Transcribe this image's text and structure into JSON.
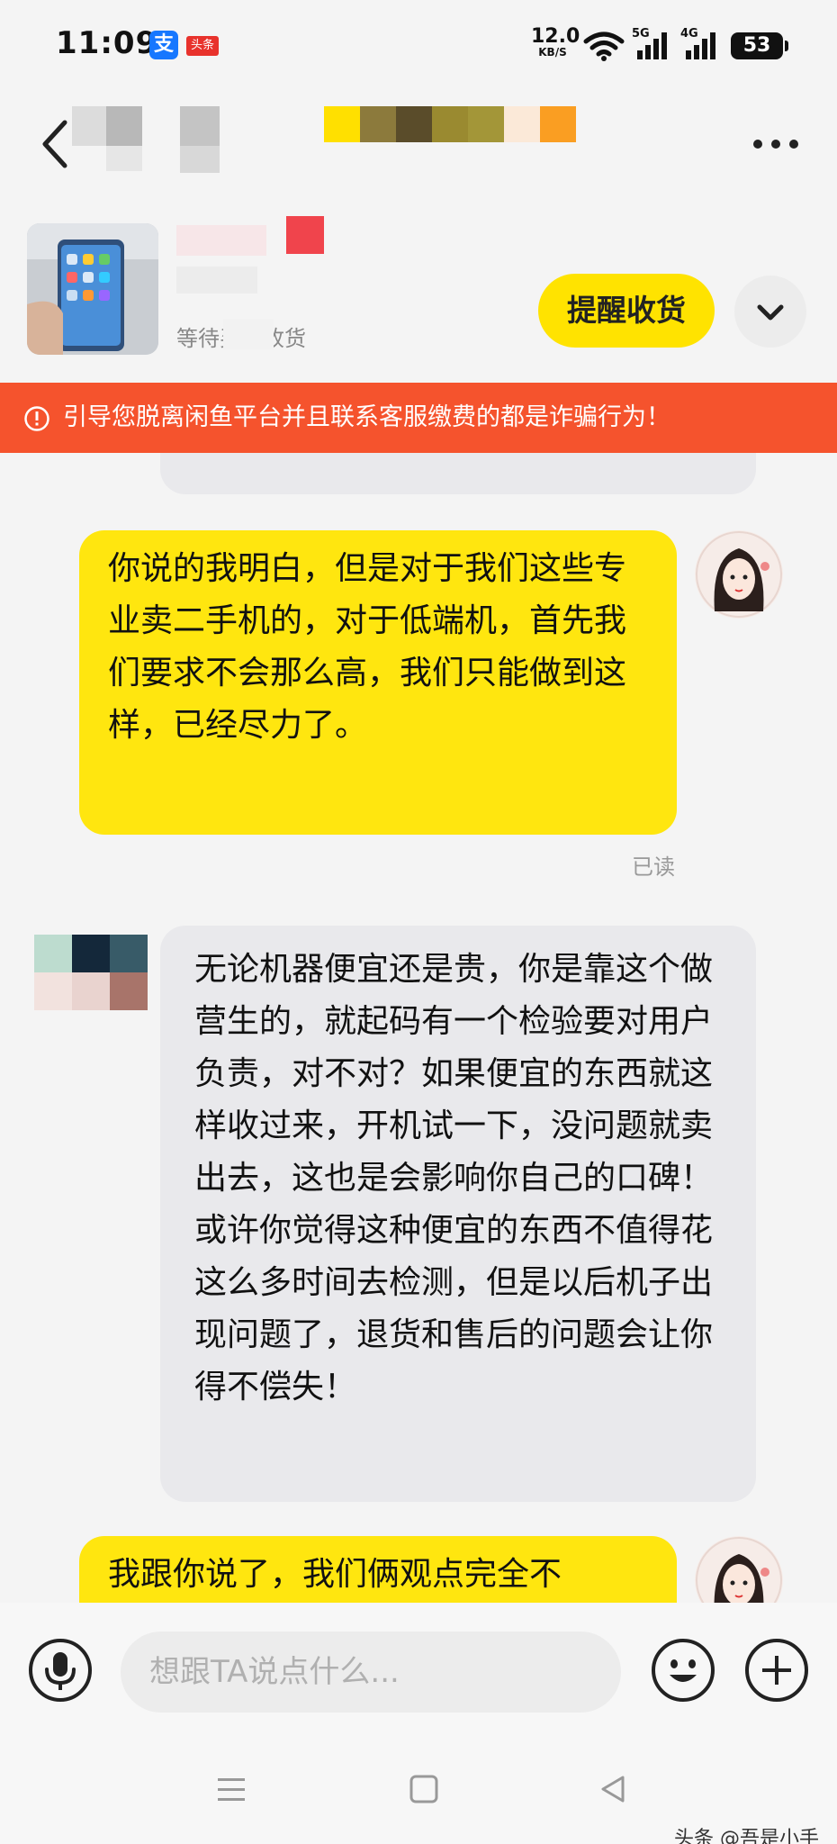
{
  "status_bar": {
    "time": "11:09",
    "alipay_glyph": "支",
    "toutiao_badge": "头条",
    "net_speed_value": "12.0",
    "net_speed_unit": "KB/S",
    "signal1_label": "5G",
    "signal2_label": "4G",
    "battery": "53"
  },
  "product": {
    "status_text": "等待买家收货",
    "remind_button": "提醒收货"
  },
  "warning": {
    "text": "引导您脱离闲鱼平台并且联系客服缴费的都是诈骗行为！"
  },
  "chat": {
    "messages": [
      {
        "side": "right",
        "text": "你说的我明白，但是对于我们这些专业卖二手机的，对于低端机，首先我们要求不会那么高，我们只能做到这样，已经尽力了。"
      },
      {
        "side": "left",
        "text": "无论机器便宜还是贵，你是靠这个做营生的，就起码有一个检验要对用户负责，对不对？如果便宜的东西就这样收过来，开机试一下，没问题就卖出去，这也是会影响你自己的口碑！或许你觉得这种便宜的东西不值得花这么多时间去检测，但是以后机子出现问题了，退货和售后的问题会让你得不偿失！"
      },
      {
        "side": "right",
        "text": "我跟你说了，我们俩观点完全不"
      }
    ],
    "read_status": "已读"
  },
  "input": {
    "placeholder": "想跟TA说点什么..."
  },
  "watermark": "头条 @吾是小手",
  "icons": [
    "back-icon",
    "more-icon",
    "chevron-down-icon",
    "warning-icon",
    "mic-icon",
    "emoji-icon",
    "plus-icon",
    "menu-icon",
    "home-icon",
    "back-triangle-icon",
    "wifi-icon",
    "signal-icon",
    "battery-icon"
  ],
  "colors": {
    "accent_yellow": "#ffe60f",
    "warning_red": "#f5532d",
    "bubble_grey": "#e9e9ec",
    "background": "#f4f4f4"
  }
}
